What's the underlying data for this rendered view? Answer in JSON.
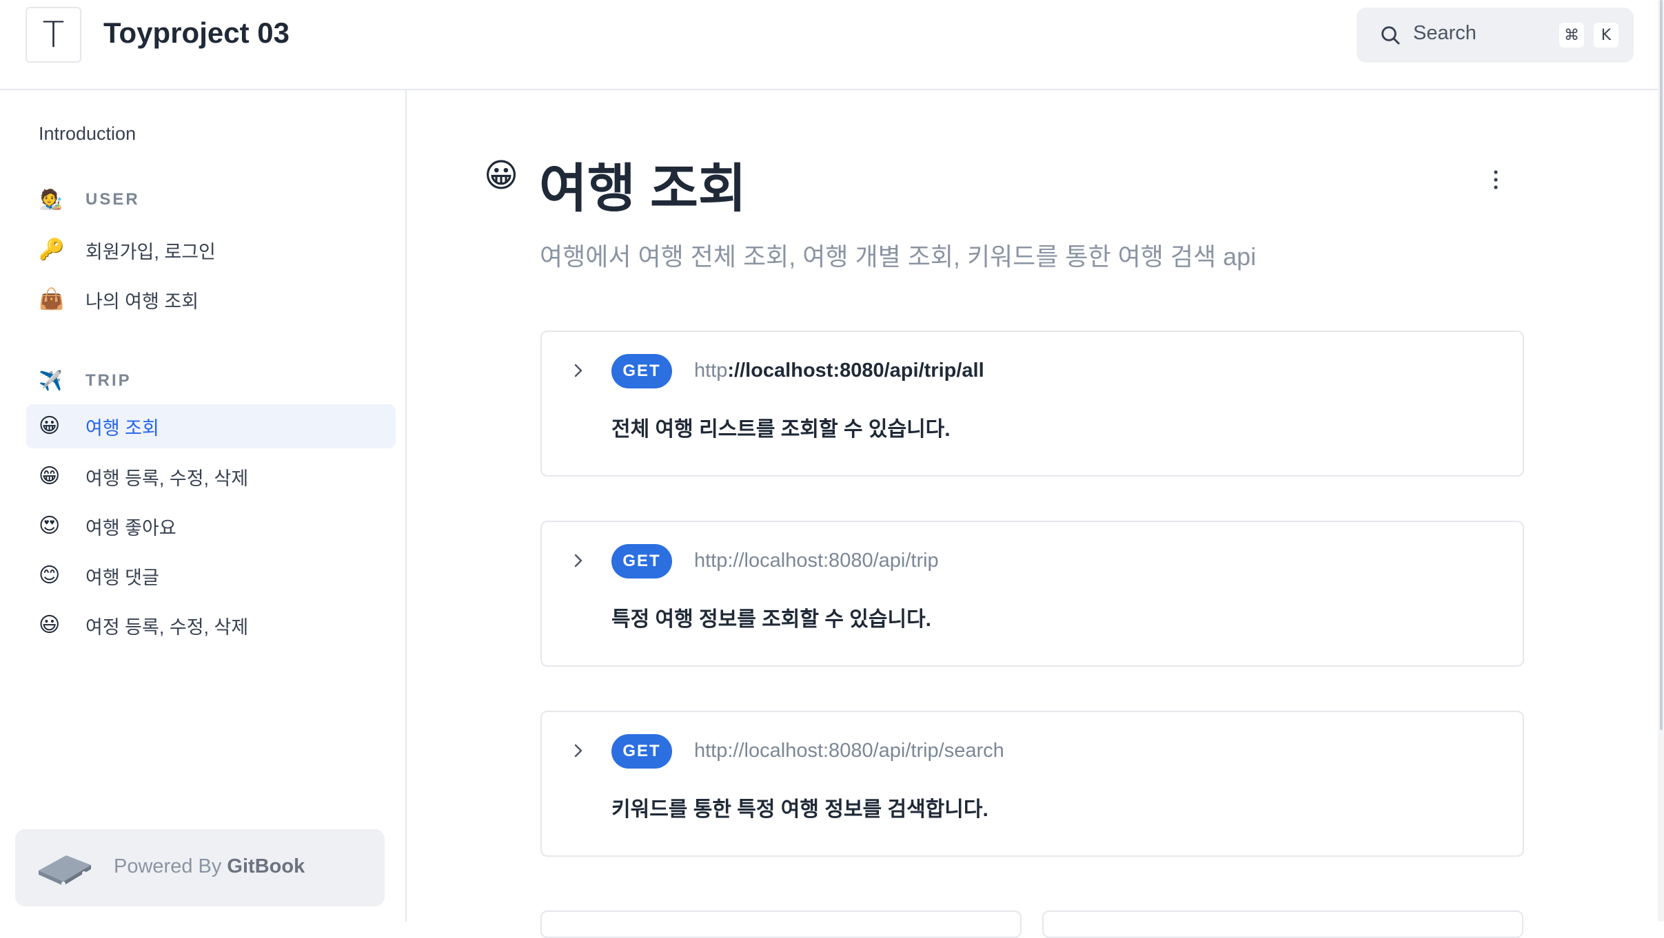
{
  "header": {
    "logo_letter": "T",
    "site_title": "Toyproject 03",
    "search": {
      "label": "Search",
      "shortcut_mod": "⌘",
      "shortcut_key": "K"
    }
  },
  "sidebar": {
    "intro": "Introduction",
    "sections": [
      {
        "emoji": "🧑‍🎨",
        "label": "USER",
        "items": [
          {
            "emoji": "🔑",
            "label": "회원가입, 로그인",
            "active": false
          },
          {
            "emoji": "👜",
            "label": "나의 여행 조회",
            "active": false
          }
        ]
      },
      {
        "emoji": "✈️",
        "label": "TRIP",
        "items": [
          {
            "emoji": "😀",
            "label": "여행 조회",
            "active": true
          },
          {
            "emoji": "😁",
            "label": "여행 등록, 수정, 삭제",
            "active": false
          },
          {
            "emoji": "😍",
            "label": "여행 좋아요",
            "active": false
          },
          {
            "emoji": "😊",
            "label": "여행 댓글",
            "active": false
          },
          {
            "emoji": "😃",
            "label": "여정 등록, 수정, 삭제",
            "active": false
          }
        ]
      }
    ],
    "powered": {
      "prefix": "Powered By",
      "brand": "GitBook"
    }
  },
  "main": {
    "page_emoji": "😀",
    "title": "여행 조회",
    "description": "여행에서 여행 전체 조회, 여행 개별 조회, 키워드를 통한 여행 검색 api",
    "api_cards": [
      {
        "method": "GET",
        "url_prefix": "http",
        "url_rest": "://localhost:8080/api/trip/all",
        "url_bold": true,
        "description": "전체 여행 리스트를 조회할 수 있습니다."
      },
      {
        "method": "GET",
        "url_prefix": "http",
        "url_rest": "://localhost:8080/api/trip",
        "url_bold": false,
        "description": "특정 여행 정보를 조회할 수 있습니다."
      },
      {
        "method": "GET",
        "url_prefix": "http",
        "url_rest": "://localhost:8080/api/trip/search",
        "url_bold": false,
        "description": "키워드를 통한 특정 여행 정보를 검색합니다."
      }
    ]
  },
  "colors": {
    "accent": "#2563eb",
    "badge": "#2b6fe0",
    "active_bg": "#eef3fc",
    "muted": "#8a94a3"
  }
}
